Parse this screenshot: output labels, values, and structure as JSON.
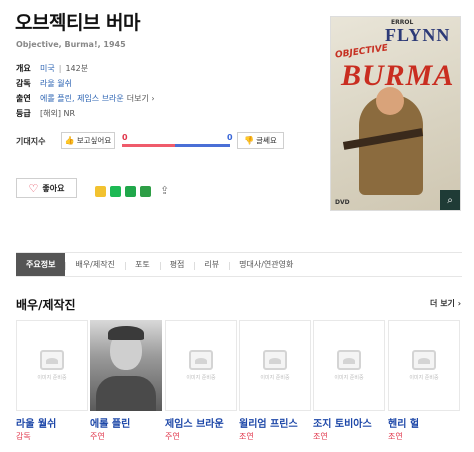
{
  "title": "오브젝티브 버마",
  "subtitle": "Objective, Burma!, 1945",
  "info": {
    "overview_label": "개요",
    "country": "미국",
    "sep": "|",
    "runtime": "142분",
    "director_label": "감독",
    "director": "라울 월쉬",
    "cast_label": "출연",
    "cast": "에롤 플린, 제임스 브라운",
    "cast_more": "더보기 ›",
    "rating_label": "등급",
    "rating": "[해외] NR"
  },
  "expect": {
    "label": "기대지수",
    "want_label": "보고싶어요",
    "want_count": "0",
    "meh_label": "글쎄요",
    "meh_count": "0"
  },
  "like": {
    "label": "좋아요"
  },
  "poster": {
    "top_text": "ERROL",
    "star_text": "FLYNN",
    "obj_text": "OBJECTIVE",
    "main_text": "BURMA",
    "dvd_text": "DVD"
  },
  "tabs": [
    {
      "label": "주요정보",
      "active": true
    },
    {
      "label": "배우/제작진"
    },
    {
      "label": "포토"
    },
    {
      "label": "평점"
    },
    {
      "label": "리뷰"
    },
    {
      "label": "명대사/연관영화"
    }
  ],
  "section": {
    "title": "배우/제작진",
    "more": "더 보기 ›",
    "placeholder_text": "이미지 준비중",
    "people": [
      {
        "name": "라울 월쉬",
        "role": "감독"
      },
      {
        "name": "에롤 플린",
        "role": "주연"
      },
      {
        "name": "제임스 브라운",
        "role": "주연"
      },
      {
        "name": "윌리엄 프린스",
        "role": "조연"
      },
      {
        "name": "조지 토비아스",
        "role": "조연"
      },
      {
        "name": "헨리 헐",
        "role": "조연"
      }
    ]
  },
  "colors": {
    "link": "#2d64b3",
    "want": "#e0364b",
    "meh": "#3a67d8",
    "cast_name": "#1d47a8",
    "tab_active_bg": "#555555"
  }
}
